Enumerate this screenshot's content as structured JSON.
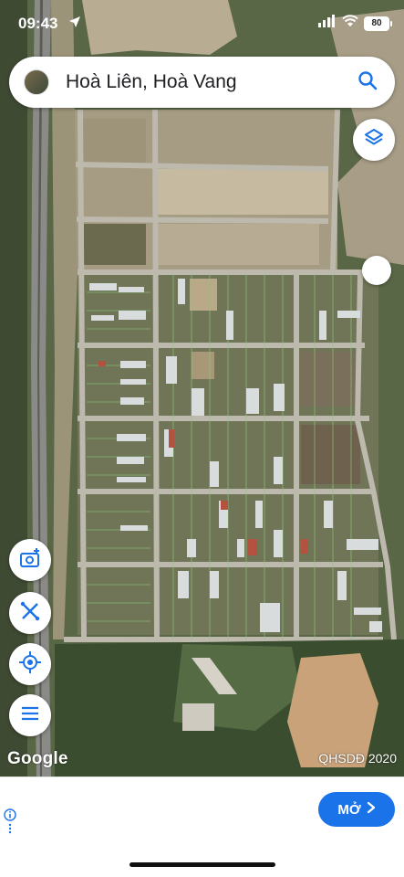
{
  "status_bar": {
    "time": "09:43",
    "battery": "80"
  },
  "search": {
    "title": "Hoà Liên, Hoà Vang"
  },
  "map": {
    "google_label": "Google",
    "copyright": "QHSDĐ 2020"
  },
  "ad": {
    "cta_label": "MỞ"
  },
  "colors": {
    "accent": "#1a73e8",
    "fab_icon": "#1a73e8"
  },
  "icons": [
    "location-arrow-icon",
    "signal-icon",
    "wifi-icon",
    "battery-icon",
    "search-icon",
    "layers-icon",
    "camera-add-icon",
    "measure-icon",
    "my-location-icon",
    "menu-icon",
    "info-icon",
    "chevron-right-icon"
  ]
}
